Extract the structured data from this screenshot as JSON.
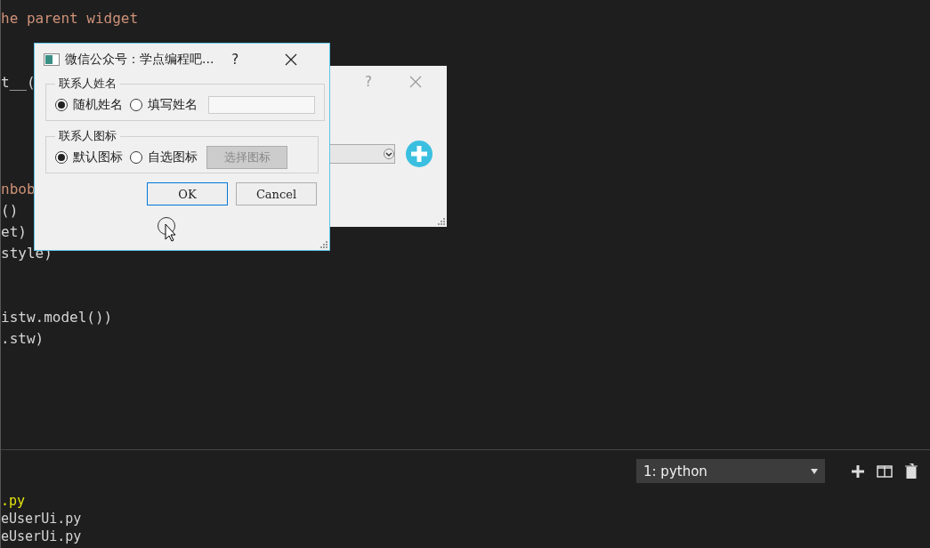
{
  "editor": {
    "lines": [
      {
        "text": "he parent widget",
        "kind": "string"
      },
      {
        "text": "t__(",
        "kind": "plain"
      },
      {
        "text": "nbob",
        "kind": "string"
      },
      {
        "text": "()",
        "kind": "plain"
      },
      {
        "text": "et)",
        "kind": "plain"
      },
      {
        "text": "style)",
        "kind": "plain"
      },
      {
        "text": "istw.model())",
        "kind": "plain"
      },
      {
        "text": ".stw)",
        "kind": "plain"
      }
    ]
  },
  "terminal": {
    "selector": "1: python",
    "lines": [
      {
        "text": ".py",
        "kind": "highlight"
      },
      {
        "text": "eUserUi.py",
        "kind": "plain"
      },
      {
        "text": "eUserUi.py",
        "kind": "plain"
      }
    ]
  },
  "back_dialog": {
    "help": "?"
  },
  "dialog": {
    "title": "微信公众号：学点编程吧...",
    "help": "?",
    "groups": [
      {
        "title": "联系人姓名",
        "options": [
          {
            "label": "随机姓名",
            "selected": true
          },
          {
            "label": "填写姓名",
            "selected": false
          }
        ],
        "extra": {
          "kind": "field"
        }
      },
      {
        "title": "联系人图标",
        "options": [
          {
            "label": "默认图标",
            "selected": true
          },
          {
            "label": "自选图标",
            "selected": false
          }
        ],
        "extra": {
          "kind": "button",
          "label": "选择图标",
          "disabled": true
        }
      }
    ],
    "buttons": [
      {
        "label": "OK",
        "focused": true
      },
      {
        "label": "Cancel",
        "focused": false
      }
    ]
  }
}
